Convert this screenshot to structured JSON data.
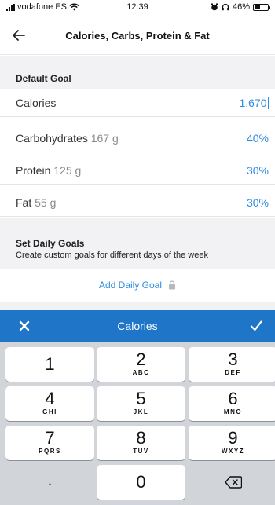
{
  "status_bar": {
    "carrier": "vodafone ES",
    "time": "12:39",
    "battery_percent": "46%",
    "battery_level": 0.46,
    "icons": [
      "signal-icon",
      "wifi-icon",
      "alarm-icon",
      "headphones-icon",
      "battery-icon"
    ]
  },
  "nav": {
    "title": "Calories, Carbs, Protein & Fat",
    "back_icon": "back-arrow-icon"
  },
  "default_goal": {
    "header": "Default Goal",
    "rows": [
      {
        "label": "Calories",
        "amount": "",
        "value": "1,670"
      },
      {
        "label": "Carbohydrates",
        "amount": "167 g",
        "value": "40%"
      },
      {
        "label": "Protein",
        "amount": "125 g",
        "value": "30%"
      },
      {
        "label": "Fat",
        "amount": "55 g",
        "value": "30%"
      }
    ]
  },
  "daily_goals": {
    "header": "Set Daily Goals",
    "subtitle": "Create custom goals for different days of the week",
    "add_label": "Add Daily Goal",
    "add_icon": "lock-icon"
  },
  "keyboard": {
    "title": "Calories",
    "close_icon": "close-icon",
    "done_icon": "checkmark-icon",
    "keys": [
      {
        "digit": "1",
        "letters": ""
      },
      {
        "digit": "2",
        "letters": "ABC"
      },
      {
        "digit": "3",
        "letters": "DEF"
      },
      {
        "digit": "4",
        "letters": "GHI"
      },
      {
        "digit": "5",
        "letters": "JKL"
      },
      {
        "digit": "6",
        "letters": "MNO"
      },
      {
        "digit": "7",
        "letters": "PQRS"
      },
      {
        "digit": "8",
        "letters": "TUV"
      },
      {
        "digit": "9",
        "letters": "WXYZ"
      },
      {
        "digit": ".",
        "letters": ""
      },
      {
        "digit": "0",
        "letters": ""
      }
    ],
    "backspace_icon": "backspace-icon"
  },
  "colors": {
    "accent": "#2f8be0",
    "toolbar": "#1f76c8",
    "section_background": "#f2f2f5",
    "keyboard_background": "#d1d4d9"
  }
}
